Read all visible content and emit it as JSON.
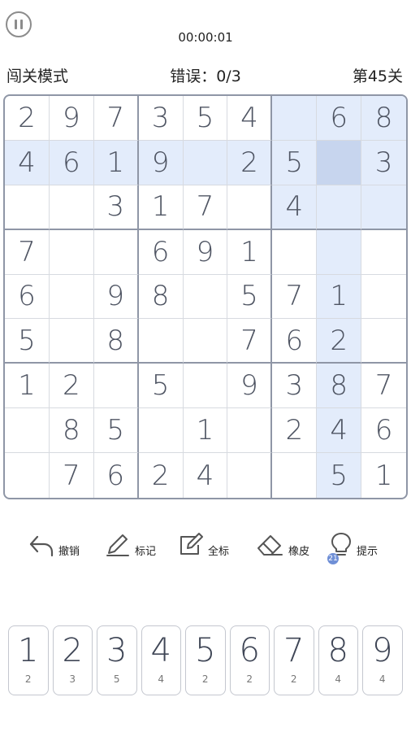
{
  "timer": "00:00:01",
  "mode_label": "闯关模式",
  "errors_label": "错误：0/3",
  "level_label": "第45关",
  "board": [
    [
      "2",
      "9",
      "7",
      "3",
      "5",
      "4",
      "",
      "6",
      "8"
    ],
    [
      "4",
      "6",
      "1",
      "9",
      "",
      "2",
      "5",
      "",
      "3"
    ],
    [
      "",
      "",
      "3",
      "1",
      "7",
      "",
      "4",
      "",
      ""
    ],
    [
      "7",
      "",
      "",
      "6",
      "9",
      "1",
      "",
      "",
      ""
    ],
    [
      "6",
      "",
      "9",
      "8",
      "",
      "5",
      "7",
      "1",
      ""
    ],
    [
      "5",
      "",
      "8",
      "",
      "",
      "7",
      "6",
      "2",
      ""
    ],
    [
      "1",
      "2",
      "",
      "5",
      "",
      "9",
      "3",
      "8",
      "7"
    ],
    [
      "",
      "8",
      "5",
      "",
      "1",
      "",
      "2",
      "4",
      "6"
    ],
    [
      "",
      "7",
      "6",
      "2",
      "4",
      "",
      "",
      "5",
      "1"
    ]
  ],
  "selected_cell": {
    "row": 1,
    "col": 7
  },
  "toolbar": {
    "undo": "撤销",
    "notes": "标记",
    "full_notes": "全标",
    "eraser": "橡皮",
    "hint": "提示",
    "hint_count": "21"
  },
  "numpad": [
    {
      "digit": "1",
      "remaining": "2"
    },
    {
      "digit": "2",
      "remaining": "3"
    },
    {
      "digit": "3",
      "remaining": "5"
    },
    {
      "digit": "4",
      "remaining": "4"
    },
    {
      "digit": "5",
      "remaining": "2"
    },
    {
      "digit": "6",
      "remaining": "2"
    },
    {
      "digit": "7",
      "remaining": "2"
    },
    {
      "digit": "8",
      "remaining": "4"
    },
    {
      "digit": "9",
      "remaining": "4"
    }
  ],
  "colors": {
    "highlight": "#e3ecfb",
    "selected": "#c7d5ee",
    "grid_border": "#8f96a6"
  }
}
